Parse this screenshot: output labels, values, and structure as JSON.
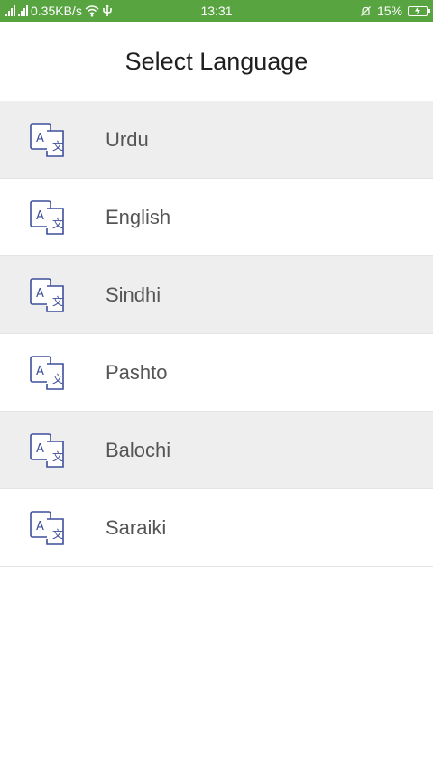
{
  "status_bar": {
    "network_speed": "0.35KB/s",
    "time": "13:31",
    "battery": "15%"
  },
  "header": {
    "title": "Select Language"
  },
  "languages": [
    {
      "label": "Urdu",
      "icon": "translate-icon"
    },
    {
      "label": "English",
      "icon": "translate-icon"
    },
    {
      "label": "Sindhi",
      "icon": "translate-icon"
    },
    {
      "label": "Pashto",
      "icon": "translate-icon"
    },
    {
      "label": "Balochi",
      "icon": "translate-icon"
    },
    {
      "label": "Saraiki",
      "icon": "translate-icon"
    }
  ],
  "colors": {
    "status_bar": "#58a441",
    "icon": "#3f4f9a",
    "row_shaded": "#eeeeee"
  }
}
